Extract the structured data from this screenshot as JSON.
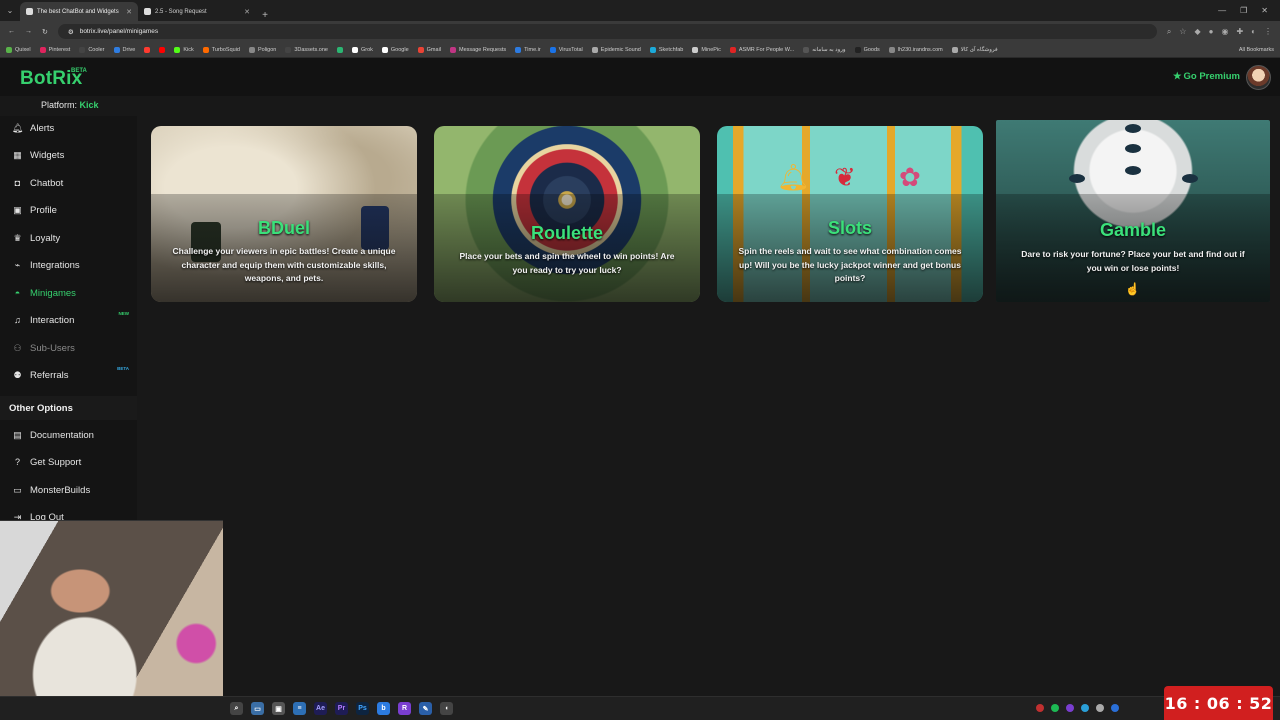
{
  "browser": {
    "tabs": [
      {
        "title": "The best ChatBot and Widgets",
        "active": true
      },
      {
        "title": "2.5 - Song Request",
        "active": false
      }
    ],
    "url": "botrix.live/panel/minigames",
    "bookmarks": [
      "Quixel",
      "Pinterest",
      "Cooler",
      "Drive",
      "",
      "",
      "Kick",
      "TurboSquid",
      "Poligon",
      "3Dassets.one",
      "",
      "Grok",
      "Google",
      "Gmail",
      "Message Requests",
      "Time.ir",
      "VirusTotal",
      "Epidemic Sound",
      "Sketchfab",
      "MinePic",
      "ASMR For People W...",
      "ورود به سامانه",
      "Goods",
      "lh230.irandns.com",
      "فروشگاه آی کالا"
    ],
    "all_bookmarks": "All Bookmarks"
  },
  "header": {
    "logo": "BotRix",
    "logo_badge": "BETA",
    "platform_label": "Platform:",
    "platform_value": "Kick",
    "premium": "Go Premium"
  },
  "sidebar": {
    "items": [
      {
        "label": "Alerts",
        "icon": "bell-icon"
      },
      {
        "label": "Widgets",
        "icon": "grid-icon"
      },
      {
        "label": "Chatbot",
        "icon": "robot-icon"
      },
      {
        "label": "Profile",
        "icon": "id-card-icon"
      },
      {
        "label": "Loyalty",
        "icon": "trophy-icon"
      },
      {
        "label": "Integrations",
        "icon": "plug-icon"
      },
      {
        "label": "Minigames",
        "icon": "gamepad-icon",
        "active": true
      },
      {
        "label": "Interaction",
        "icon": "music-icon",
        "badge": "NEW"
      },
      {
        "label": "Sub-Users",
        "icon": "users-icon"
      },
      {
        "label": "Referrals",
        "icon": "people-icon",
        "badge": "BETA"
      }
    ],
    "other_title": "Other Options",
    "other_items": [
      {
        "label": "Documentation",
        "icon": "book-icon"
      },
      {
        "label": "Get Support",
        "icon": "question-icon"
      },
      {
        "label": "MonsterBuilds",
        "icon": "monitor-icon"
      },
      {
        "label": "Log Out",
        "icon": "logout-icon"
      }
    ]
  },
  "games": [
    {
      "title": "BDuel",
      "description": "Challenge your viewers in epic battles! Create a unique character and equip them with customizable skills, weapons, and pets."
    },
    {
      "title": "Roulette",
      "description": "Place your bets and spin the wheel to win points! Are you ready to try your luck?"
    },
    {
      "title": "Slots",
      "description": "Spin the reels and wait to see what combination comes up! Will you be the lucky jackpot winner and get bonus points?"
    },
    {
      "title": "Gamble",
      "description": "Dare to risk your fortune? Place your bet and find out if you win or lose points!"
    }
  ],
  "clock": "16 : 06 : 52",
  "colors": {
    "accent": "#36d06e",
    "background": "#181818",
    "clock": "#d11f1f"
  }
}
